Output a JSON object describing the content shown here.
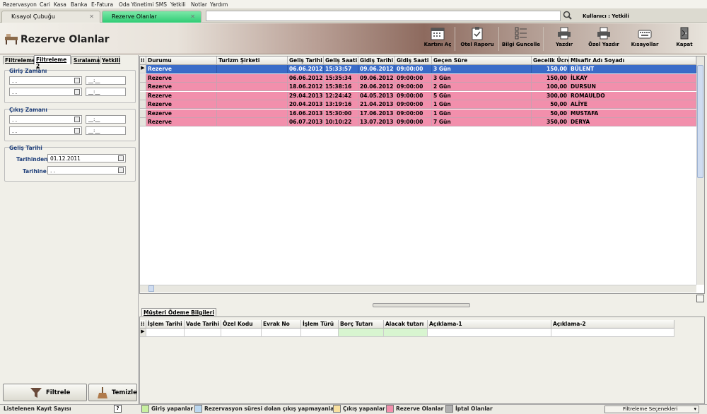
{
  "menu": [
    "Rezervasyon",
    "Cari",
    "Kasa",
    "Banka",
    "E-Fatura",
    "Oda Yönetimi",
    "SMS",
    "Yetkili",
    "Notlar",
    "Yardım"
  ],
  "tabs": [
    {
      "label": "Kısayol Çubuğu",
      "active": false
    },
    {
      "label": "Rezerve Olanlar",
      "active": true
    }
  ],
  "user_label": "Kullanıcı : Yetkili",
  "page_title": "Rezerve Olanlar",
  "toolbar": [
    {
      "label": "Kartını Aç",
      "icon": "calendar-icon"
    },
    {
      "label": "Otel Raporu",
      "icon": "clipboard-icon"
    },
    {
      "label": "Bilgi Guncelle",
      "icon": "checklist-icon"
    },
    {
      "label": "Yazdır",
      "icon": "printer-icon"
    },
    {
      "label": "Özel Yazdır",
      "icon": "printer-icon"
    },
    {
      "label": "Kısayollar",
      "icon": "keyboard-icon"
    },
    {
      "label": "Kapat",
      "icon": "exit-icon"
    }
  ],
  "left_tabs": [
    "Filtreleme",
    "Filtreleme 2",
    "Sıralama",
    "Yetkili"
  ],
  "filters": {
    "giris_label": "Giriş Zamanı",
    "cikis_label": "Çıkış Zamanı",
    "gelis_label": "Geliş Tarihi",
    "empty_date": ". .",
    "empty_time": "__:__",
    "tarihinden_label": "Tarihinden",
    "tarihinden_value": "01.12.2011",
    "tarihine_label": "Tarihine",
    "tarihine_value": ". ."
  },
  "buttons": {
    "filter": "Filtrele",
    "clear": "Temizle"
  },
  "grid": {
    "columns": [
      "Durumu",
      "Turizm Şirketi",
      "Geliş Tarihi",
      "Geliş Saati",
      "Gidiş Tarihi",
      "Gidiş Saati",
      "Geçen Süre",
      "Gecelik Ücret",
      "Misafir Adı Soyadı"
    ],
    "rows": [
      [
        "Rezerve",
        "",
        "06.06.2012",
        "15:33:57",
        "09.06.2012",
        "09:00:00",
        "3 Gün",
        "150,00",
        "BÜLENT"
      ],
      [
        "Rezerve",
        "",
        "06.06.2012",
        "15:35:34",
        "09.06.2012",
        "09:00:00",
        "3 Gün",
        "150,00",
        "İLKAY"
      ],
      [
        "Rezerve",
        "",
        "18.06.2012",
        "15:38:16",
        "20.06.2012",
        "09:00:00",
        "2 Gün",
        "100,00",
        "DURSUN"
      ],
      [
        "Rezerve",
        "",
        "29.04.2013",
        "12:24:42",
        "04.05.2013",
        "09:00:00",
        "5 Gün",
        "300,00",
        "ROMAULDO"
      ],
      [
        "Rezerve",
        "",
        "20.04.2013",
        "13:19:16",
        "21.04.2013",
        "09:00:00",
        "1 Gün",
        "50,00",
        "ALİYE"
      ],
      [
        "Rezerve",
        "",
        "16.06.2013",
        "15:30:00",
        "17.06.2013",
        "09:00:00",
        "1 Gün",
        "50,00",
        "MUSTAFA"
      ],
      [
        "Rezerve",
        "",
        "06.07.2013",
        "10:10:22",
        "13.07.2013",
        "09:00:00",
        "7 Gün",
        "350,00",
        "DERYA"
      ]
    ],
    "row_color": "#f28fac",
    "selected_color": "#3a6cc8"
  },
  "payment": {
    "tab_label": "Müşteri Ödeme Bilgileri",
    "columns": [
      "İşlem Tarihi",
      "Vade Tarihi",
      "Özel Kodu",
      "Evrak No",
      "İşlem Türü",
      "Borç Tutarı",
      "Alacak tutarı",
      "Açıklama-1",
      "Açıklama-2"
    ]
  },
  "status": {
    "record_count_label": "Listelenen Kayıt Sayısı",
    "help": "?",
    "legend": [
      {
        "label": "Giriş yapanlar",
        "color": "#c8f0a0"
      },
      {
        "label": "Rezervasyon süresi dolan çıkış yapmayanlar",
        "color": "#bcd8f0"
      },
      {
        "label": "Çıkış yapanlar",
        "color": "#f8e0a0"
      },
      {
        "label": "Rezerve Olanlar",
        "color": "#f28fac"
      },
      {
        "label": "İptal Olanlar",
        "color": "#b0b0b0"
      }
    ],
    "filter_settings": "Filtreleme Seçenekleri"
  }
}
